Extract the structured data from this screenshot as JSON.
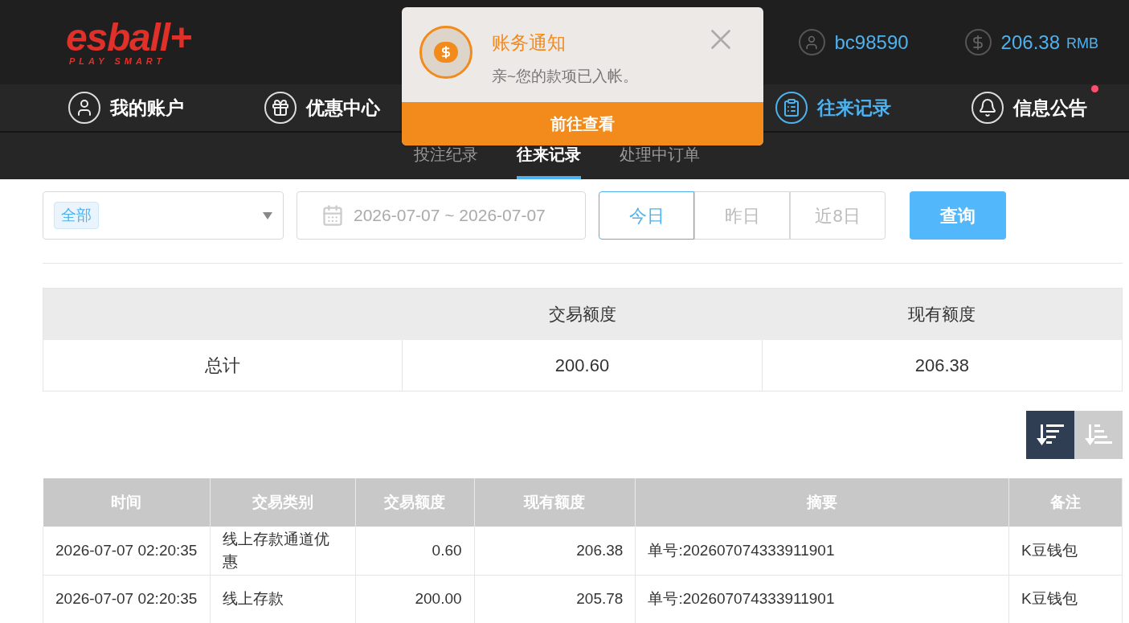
{
  "header": {
    "logo": "esball+",
    "tagline": "PLAY SMART",
    "username": "bc98590",
    "balance": "206.38",
    "currency": "RMB"
  },
  "nav": [
    {
      "label": "我的账户",
      "kind": "account",
      "selected": false,
      "notification": false
    },
    {
      "label": "优惠中心",
      "kind": "gift",
      "selected": false,
      "notification": false
    },
    {
      "label": "往来记录",
      "kind": "records",
      "selected": true,
      "notification": false
    },
    {
      "label": "信息公告",
      "kind": "bell",
      "selected": false,
      "notification": true
    }
  ],
  "sub_tabs": [
    {
      "label": "投注纪录",
      "selected": false
    },
    {
      "label": "往来记录",
      "selected": true
    },
    {
      "label": "处理中订单",
      "selected": false
    }
  ],
  "notification": {
    "title": "账务通知",
    "message": "亲~您的款项已入帐。",
    "action": "前往查看"
  },
  "filters": {
    "type_tag": "全部",
    "date_range": "2026-07-07 ~ 2026-07-07",
    "quick_ranges": [
      {
        "label": "今日",
        "selected": true
      },
      {
        "label": "昨日",
        "selected": false
      },
      {
        "label": "近8日",
        "selected": false
      }
    ],
    "query_button": "查询"
  },
  "summary": {
    "columns": [
      "交易额度",
      "现有额度"
    ],
    "row_label": "总计",
    "values": [
      "200.60",
      "206.38"
    ]
  },
  "sort_buttons": [
    {
      "kind": "desc",
      "selected": true
    },
    {
      "kind": "asc",
      "selected": false
    }
  ],
  "table": {
    "columns": [
      "时间",
      "交易类别",
      "交易额度",
      "现有额度",
      "摘要",
      "备注"
    ],
    "rows": [
      [
        "2026-07-07 02:20:35",
        "线上存款通道优惠",
        "0.60",
        "206.38",
        "单号:202607074333911901",
        "K豆钱包"
      ],
      [
        "2026-07-07 02:20:35",
        "线上存款",
        "200.00",
        "205.78",
        "单号:202607074333911901",
        "K豆钱包"
      ]
    ]
  }
}
